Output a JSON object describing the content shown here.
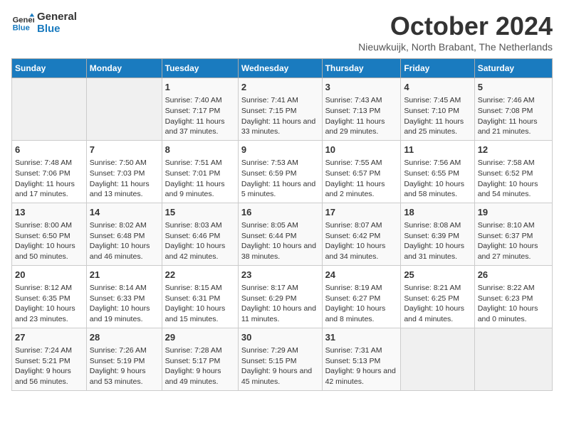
{
  "logo": {
    "line1": "General",
    "line2": "Blue"
  },
  "title": "October 2024",
  "location": "Nieuwkuijk, North Brabant, The Netherlands",
  "header_days": [
    "Sunday",
    "Monday",
    "Tuesday",
    "Wednesday",
    "Thursday",
    "Friday",
    "Saturday"
  ],
  "weeks": [
    [
      {
        "day": "",
        "content": ""
      },
      {
        "day": "",
        "content": ""
      },
      {
        "day": "1",
        "content": "Sunrise: 7:40 AM\nSunset: 7:17 PM\nDaylight: 11 hours and 37 minutes."
      },
      {
        "day": "2",
        "content": "Sunrise: 7:41 AM\nSunset: 7:15 PM\nDaylight: 11 hours and 33 minutes."
      },
      {
        "day": "3",
        "content": "Sunrise: 7:43 AM\nSunset: 7:13 PM\nDaylight: 11 hours and 29 minutes."
      },
      {
        "day": "4",
        "content": "Sunrise: 7:45 AM\nSunset: 7:10 PM\nDaylight: 11 hours and 25 minutes."
      },
      {
        "day": "5",
        "content": "Sunrise: 7:46 AM\nSunset: 7:08 PM\nDaylight: 11 hours and 21 minutes."
      }
    ],
    [
      {
        "day": "6",
        "content": "Sunrise: 7:48 AM\nSunset: 7:06 PM\nDaylight: 11 hours and 17 minutes."
      },
      {
        "day": "7",
        "content": "Sunrise: 7:50 AM\nSunset: 7:03 PM\nDaylight: 11 hours and 13 minutes."
      },
      {
        "day": "8",
        "content": "Sunrise: 7:51 AM\nSunset: 7:01 PM\nDaylight: 11 hours and 9 minutes."
      },
      {
        "day": "9",
        "content": "Sunrise: 7:53 AM\nSunset: 6:59 PM\nDaylight: 11 hours and 5 minutes."
      },
      {
        "day": "10",
        "content": "Sunrise: 7:55 AM\nSunset: 6:57 PM\nDaylight: 11 hours and 2 minutes."
      },
      {
        "day": "11",
        "content": "Sunrise: 7:56 AM\nSunset: 6:55 PM\nDaylight: 10 hours and 58 minutes."
      },
      {
        "day": "12",
        "content": "Sunrise: 7:58 AM\nSunset: 6:52 PM\nDaylight: 10 hours and 54 minutes."
      }
    ],
    [
      {
        "day": "13",
        "content": "Sunrise: 8:00 AM\nSunset: 6:50 PM\nDaylight: 10 hours and 50 minutes."
      },
      {
        "day": "14",
        "content": "Sunrise: 8:02 AM\nSunset: 6:48 PM\nDaylight: 10 hours and 46 minutes."
      },
      {
        "day": "15",
        "content": "Sunrise: 8:03 AM\nSunset: 6:46 PM\nDaylight: 10 hours and 42 minutes."
      },
      {
        "day": "16",
        "content": "Sunrise: 8:05 AM\nSunset: 6:44 PM\nDaylight: 10 hours and 38 minutes."
      },
      {
        "day": "17",
        "content": "Sunrise: 8:07 AM\nSunset: 6:42 PM\nDaylight: 10 hours and 34 minutes."
      },
      {
        "day": "18",
        "content": "Sunrise: 8:08 AM\nSunset: 6:39 PM\nDaylight: 10 hours and 31 minutes."
      },
      {
        "day": "19",
        "content": "Sunrise: 8:10 AM\nSunset: 6:37 PM\nDaylight: 10 hours and 27 minutes."
      }
    ],
    [
      {
        "day": "20",
        "content": "Sunrise: 8:12 AM\nSunset: 6:35 PM\nDaylight: 10 hours and 23 minutes."
      },
      {
        "day": "21",
        "content": "Sunrise: 8:14 AM\nSunset: 6:33 PM\nDaylight: 10 hours and 19 minutes."
      },
      {
        "day": "22",
        "content": "Sunrise: 8:15 AM\nSunset: 6:31 PM\nDaylight: 10 hours and 15 minutes."
      },
      {
        "day": "23",
        "content": "Sunrise: 8:17 AM\nSunset: 6:29 PM\nDaylight: 10 hours and 11 minutes."
      },
      {
        "day": "24",
        "content": "Sunrise: 8:19 AM\nSunset: 6:27 PM\nDaylight: 10 hours and 8 minutes."
      },
      {
        "day": "25",
        "content": "Sunrise: 8:21 AM\nSunset: 6:25 PM\nDaylight: 10 hours and 4 minutes."
      },
      {
        "day": "26",
        "content": "Sunrise: 8:22 AM\nSunset: 6:23 PM\nDaylight: 10 hours and 0 minutes."
      }
    ],
    [
      {
        "day": "27",
        "content": "Sunrise: 7:24 AM\nSunset: 5:21 PM\nDaylight: 9 hours and 56 minutes."
      },
      {
        "day": "28",
        "content": "Sunrise: 7:26 AM\nSunset: 5:19 PM\nDaylight: 9 hours and 53 minutes."
      },
      {
        "day": "29",
        "content": "Sunrise: 7:28 AM\nSunset: 5:17 PM\nDaylight: 9 hours and 49 minutes."
      },
      {
        "day": "30",
        "content": "Sunrise: 7:29 AM\nSunset: 5:15 PM\nDaylight: 9 hours and 45 minutes."
      },
      {
        "day": "31",
        "content": "Sunrise: 7:31 AM\nSunset: 5:13 PM\nDaylight: 9 hours and 42 minutes."
      },
      {
        "day": "",
        "content": ""
      },
      {
        "day": "",
        "content": ""
      }
    ]
  ]
}
